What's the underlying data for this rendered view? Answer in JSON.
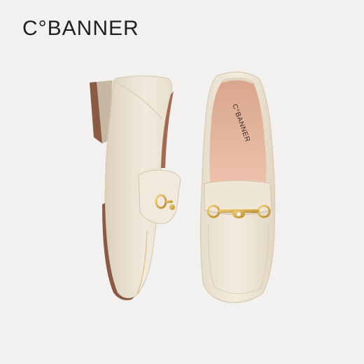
{
  "brand": {
    "logo_text": "C°BANNER"
  },
  "insole": {
    "logo_text": "C°BANNER"
  },
  "colors": {
    "background": "#f3f1ef",
    "leather": "#efe7d9",
    "leather_shadow": "#d9cdb9",
    "insole": "#e9b8a0",
    "heel": "#8a5a44",
    "hardware": "#c9a24a"
  }
}
